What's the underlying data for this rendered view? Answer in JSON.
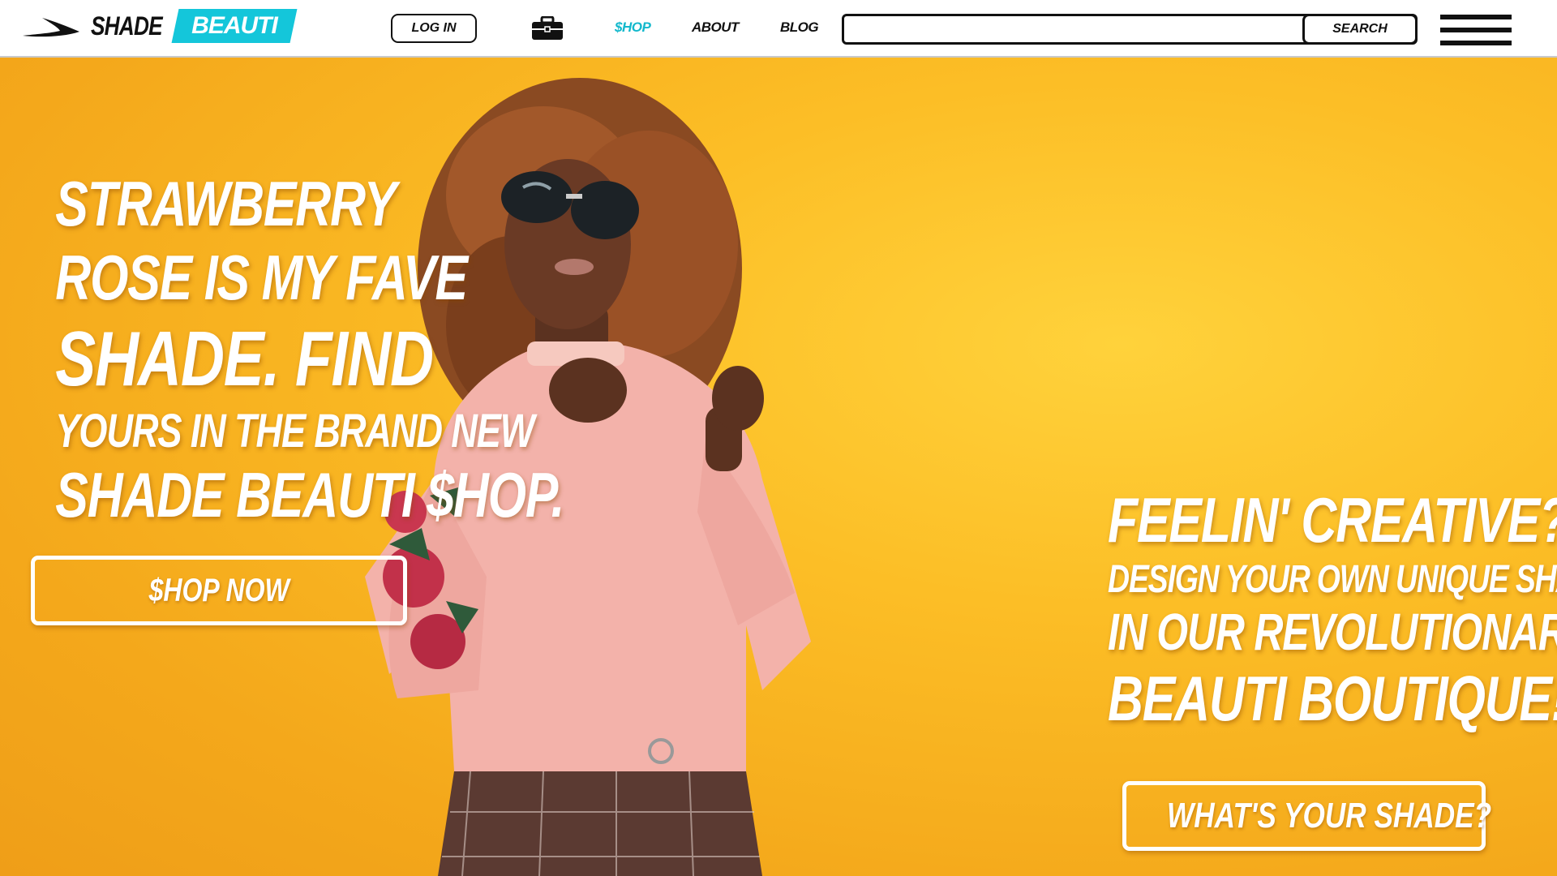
{
  "nav": {
    "brand_name": "SHADE",
    "brand_badge": "BEAUTI",
    "login_label": "LOG IN",
    "links": [
      {
        "label": "$HOP",
        "active": true
      },
      {
        "label": "ABOUT",
        "active": false
      },
      {
        "label": "BLOG",
        "active": false
      }
    ],
    "search_value": "",
    "search_placeholder": "",
    "search_button": "SEARCH",
    "icons": {
      "logo": "swoosh-logo-icon",
      "shop": "briefcase-icon",
      "menu": "hamburger-menu-icon"
    }
  },
  "hero": {
    "image": "woman-in-sunglasses-pink-floral-sweater",
    "left": {
      "lines": [
        "STRAWBERRY",
        "ROSE IS MY FAVE",
        "SHADE. FIND",
        "YOURS IN THE BRAND NEW",
        "SHADE BEAUTI $HOP."
      ],
      "cta": "$HOP NOW"
    },
    "right": {
      "lines": [
        "FEELIN' CREATIVE?",
        "DESIGN YOUR OWN UNIQUE SHADE",
        "IN OUR REVOLUTIONARY",
        "BEAUTI BOUTIQUE!"
      ],
      "cta": "WHAT'S YOUR SHADE?"
    }
  },
  "colors": {
    "accent": "#14c6da",
    "hero_background": "#f9b61e",
    "text_light": "#ffffff",
    "text_dark": "#111111"
  }
}
